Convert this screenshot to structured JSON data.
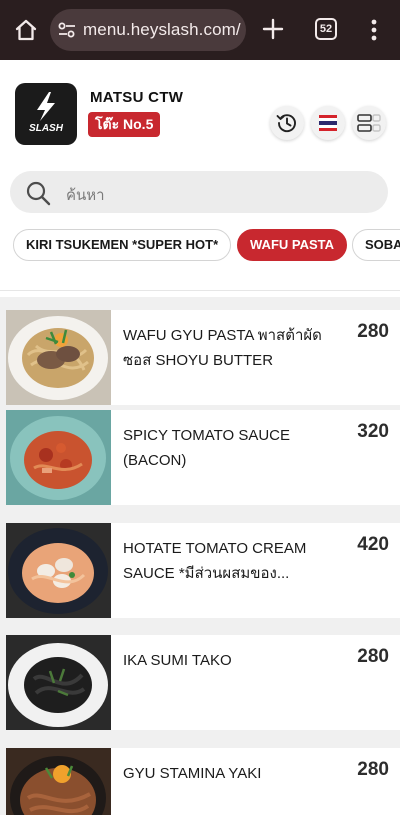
{
  "browser": {
    "url": "menu.heyslash.com/",
    "tab_count": "52"
  },
  "restaurant": {
    "logo_text": "SLASH",
    "name": "MATSU CTW",
    "table_badge": "โต๊ะ No.5"
  },
  "search": {
    "placeholder": "ค้นหา"
  },
  "categories": [
    {
      "label": "KIRI TSUKEMEN *SUPER HOT*",
      "active": false
    },
    {
      "label": "WAFU PASTA",
      "active": true
    },
    {
      "label": "SOBA",
      "active": false
    }
  ],
  "menu_items": [
    {
      "name": "WAFU GYU PASTA พาสต้าผัดซอส SHOYU BUTTER",
      "price": "280"
    },
    {
      "name": "SPICY TOMATO SAUCE (BACON)",
      "price": "320"
    },
    {
      "name": "HOTATE TOMATO CREAM SAUCE *มีส่วนผสมของ...",
      "price": "420"
    },
    {
      "name": "IKA SUMI TAKO",
      "price": "280"
    },
    {
      "name": "GYU STAMINA YAKI",
      "price": "280"
    }
  ],
  "colors": {
    "brand_red": "#c8282f",
    "browser_bar": "#2a1e1f",
    "url_pill": "#4a3a3c",
    "search_bg": "#ececec"
  },
  "icons": {
    "browser": [
      "home-icon",
      "site-settings-icon",
      "new-tab-icon",
      "tab-switcher-icon",
      "more-vert-icon"
    ],
    "header": [
      "history-icon",
      "thai-flag-icon",
      "view-toggle-icon"
    ],
    "search": "search-icon",
    "logo": "lightning-bolt-icon"
  }
}
